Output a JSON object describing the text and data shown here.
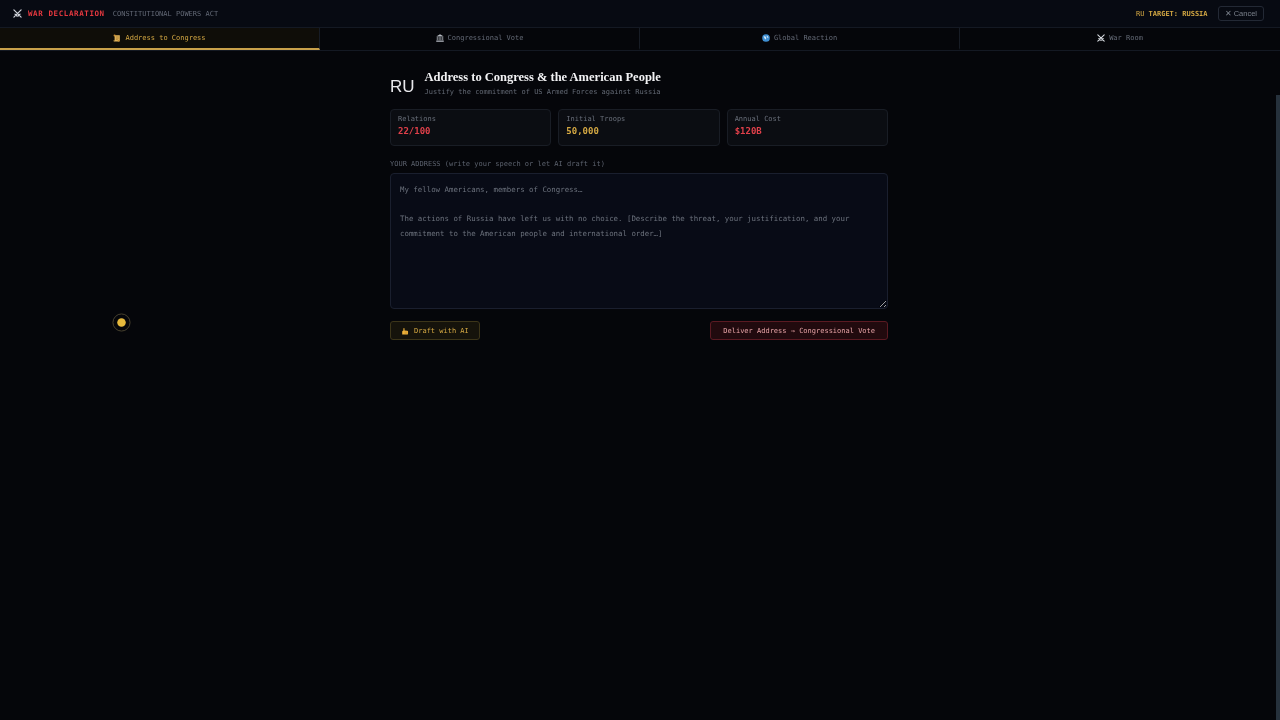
{
  "header": {
    "title": "WAR DECLARATION",
    "subtitle": "CONSTITUTIONAL POWERS ACT",
    "target_flag": "RU",
    "target": "TARGET: RUSSIA",
    "cancel_button": "✕ Cancel"
  },
  "tabs": [
    {
      "label": "Address to Congress",
      "selected": true
    },
    {
      "label": "Congressional Vote",
      "selected": false
    },
    {
      "label": "Global Reaction",
      "selected": false
    },
    {
      "label": "War Room",
      "selected": false
    }
  ],
  "heading": {
    "flag": "RU",
    "title": "Address to Congress & the American People",
    "subtitle": "Justify the commitment of US Armed Forces against Russia"
  },
  "stats": [
    {
      "label": "Relations",
      "value": "22/100",
      "color": "#e0404a"
    },
    {
      "label": "Initial Troops",
      "value": "50,000",
      "color": "#d4a843"
    },
    {
      "label": "Annual Cost",
      "value": "$120B",
      "color": "#e0404a"
    }
  ],
  "address": {
    "label": "YOUR ADDRESS (write your speech or let AI draft it)",
    "placeholder": "My fellow Americans, members of Congress…\n\nThe actions of Russia have left us with no choice. [Describe the threat, your justification, and your commitment to the American people and international order…]"
  },
  "buttons": {
    "draft": "Draft with AI",
    "deliver": "Deliver Address → Congressional Vote"
  }
}
